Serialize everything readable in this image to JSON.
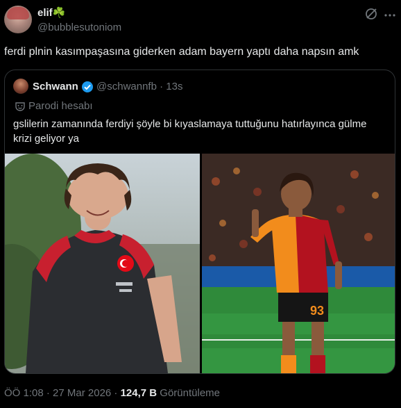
{
  "tweet": {
    "author_name": "elif☘️",
    "author_handle": "@bubblesutoniom",
    "text": "ferdi plnin kasımpaşasına giderken adam bayern yaptı daha napsın amk",
    "timestamp": "ÖÖ 1:08 · 27 Mar 2026 · ",
    "views_count": "124,7 B",
    "views_label": " Görüntüleme"
  },
  "quote": {
    "author_name": "Schwann",
    "author_handle": "@schwannfb",
    "separator": " · ",
    "time_ago": "13s",
    "parody_label": "Parodi hesabı",
    "text": "gslilerin zamanında ferdiyi şöyle bi kıyaslamaya tuttuğunu hatırlayınca gülme krizi geliyor ya"
  },
  "icons": {
    "grok": "grok-icon",
    "more": "more-icon",
    "verified": "verified-icon",
    "parody": "parody-mask-icon"
  },
  "colors": {
    "background": "#000000",
    "text": "#e7e9ea",
    "secondary": "#71767b",
    "border": "#2f3336",
    "verified": "#1d9bf0"
  }
}
